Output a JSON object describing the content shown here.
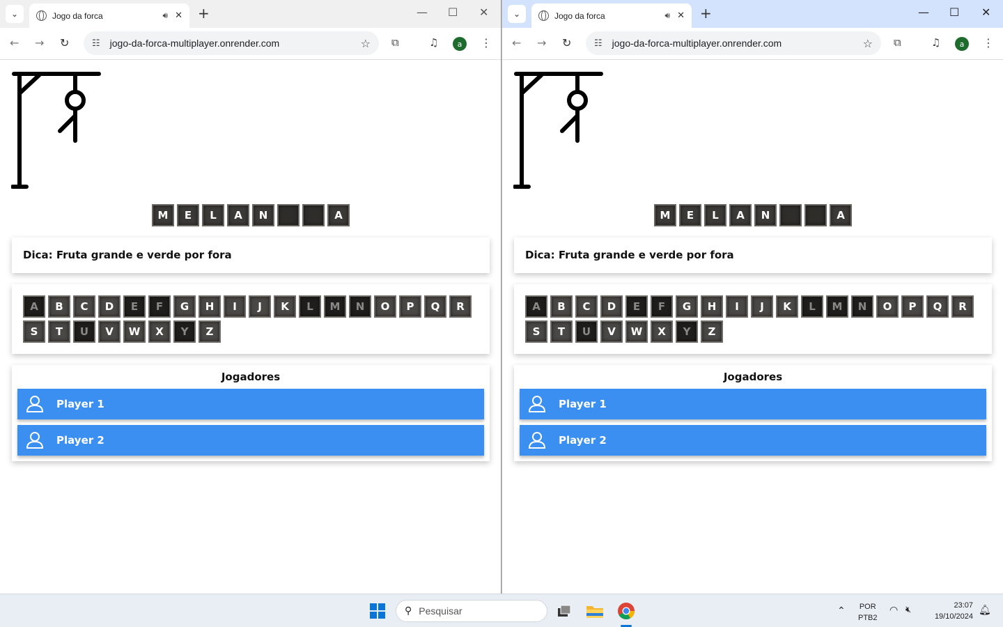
{
  "browser": {
    "tab_title": "Jogo da forca",
    "url": "jogo-da-forca-multiplayer.onrender.com",
    "avatar_letter": "a"
  },
  "game": {
    "word": [
      "M",
      "E",
      "L",
      "A",
      "N",
      "",
      "",
      "A"
    ],
    "hint": "Dica: Fruta grande e verde por fora",
    "keys": [
      "A",
      "B",
      "C",
      "D",
      "E",
      "F",
      "G",
      "H",
      "I",
      "J",
      "K",
      "L",
      "M",
      "N",
      "O",
      "P",
      "Q",
      "R",
      "S",
      "T",
      "U",
      "V",
      "W",
      "X",
      "Y",
      "Z"
    ],
    "used_keys": [
      "A",
      "E",
      "F",
      "L",
      "M",
      "N",
      "U",
      "Y"
    ],
    "players_title": "Jogadores",
    "players": [
      "Player 1",
      "Player 2"
    ],
    "accent": "#3a8ff0"
  },
  "taskbar": {
    "search_placeholder": "Pesquisar",
    "lang_top": "POR",
    "lang_bottom": "PTB2",
    "time": "23:07",
    "date": "19/10/2024"
  }
}
